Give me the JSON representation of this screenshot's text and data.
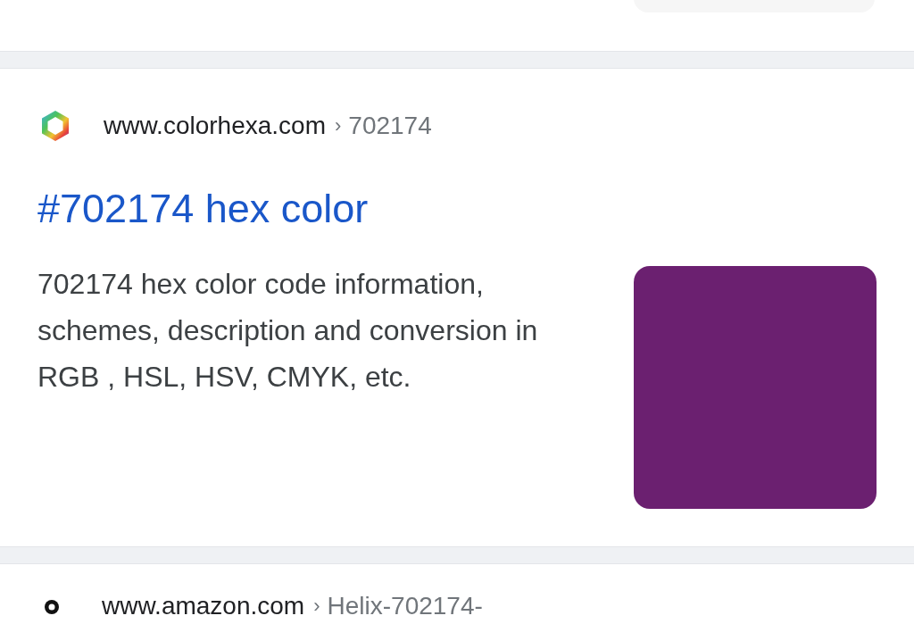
{
  "results": [
    {
      "site": "www.colorhexa.com",
      "separator": "›",
      "path": "702174",
      "title": "#702174 hex color",
      "snippet": "702174 hex color code information, schemes, description and conversion in RGB , HSL, HSV, CMYK, etc."
    },
    {
      "site": "www.amazon.com",
      "separator": "›",
      "path": "Helix-702174-"
    }
  ]
}
